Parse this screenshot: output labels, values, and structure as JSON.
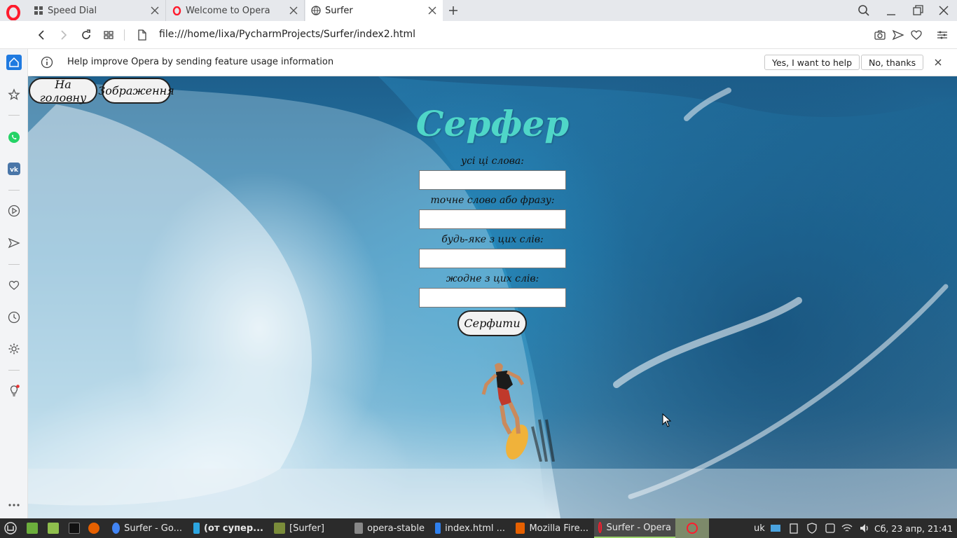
{
  "browser": {
    "tabs": [
      {
        "label": "Speed Dial",
        "icon": "grid-icon"
      },
      {
        "label": "Welcome to Opera",
        "icon": "opera-icon"
      },
      {
        "label": "Surfer",
        "icon": "globe-icon",
        "active": true
      }
    ],
    "url": "file:///home/lixa/PycharmProjects/Surfer/index2.html"
  },
  "infobar": {
    "message": "Help improve Opera by sending feature usage information",
    "accept_label": "Yes, I want to help",
    "decline_label": "No, thanks"
  },
  "page": {
    "nav": {
      "home_label": "На головну",
      "images_label": "Зображення"
    },
    "title": "Серфер",
    "fields": [
      {
        "label": "усі ці слова:",
        "value": ""
      },
      {
        "label": "точне слово або фразу:",
        "value": ""
      },
      {
        "label": "будь-яке з цих слів:",
        "value": ""
      },
      {
        "label": "жодне з цих слів:",
        "value": ""
      }
    ],
    "submit_label": "Серфити"
  },
  "taskbar": {
    "items": [
      {
        "label": "Surfer - Go...",
        "color": "#4285f4"
      },
      {
        "label": "(от супер...",
        "color": "#2ca5e0"
      },
      {
        "label": "[Surfer]",
        "color": "#7a8c3a"
      },
      {
        "label": "opera-stable",
        "color": "#888888"
      },
      {
        "label": "index.html ...",
        "color": "#2f80ed"
      },
      {
        "label": "Mozilla Fire...",
        "color": "#e66000"
      },
      {
        "label": "Surfer - Opera",
        "color": "#ff1b2d",
        "active": true
      }
    ],
    "lang": "uk",
    "clock": "Сб, 23 апр, 21:41"
  },
  "colors": {
    "title": "#4fd6c8",
    "opera_red": "#ff1b2d",
    "sidebar_accent": "#1f7ae0",
    "taskbar": "#2b2b2b"
  }
}
